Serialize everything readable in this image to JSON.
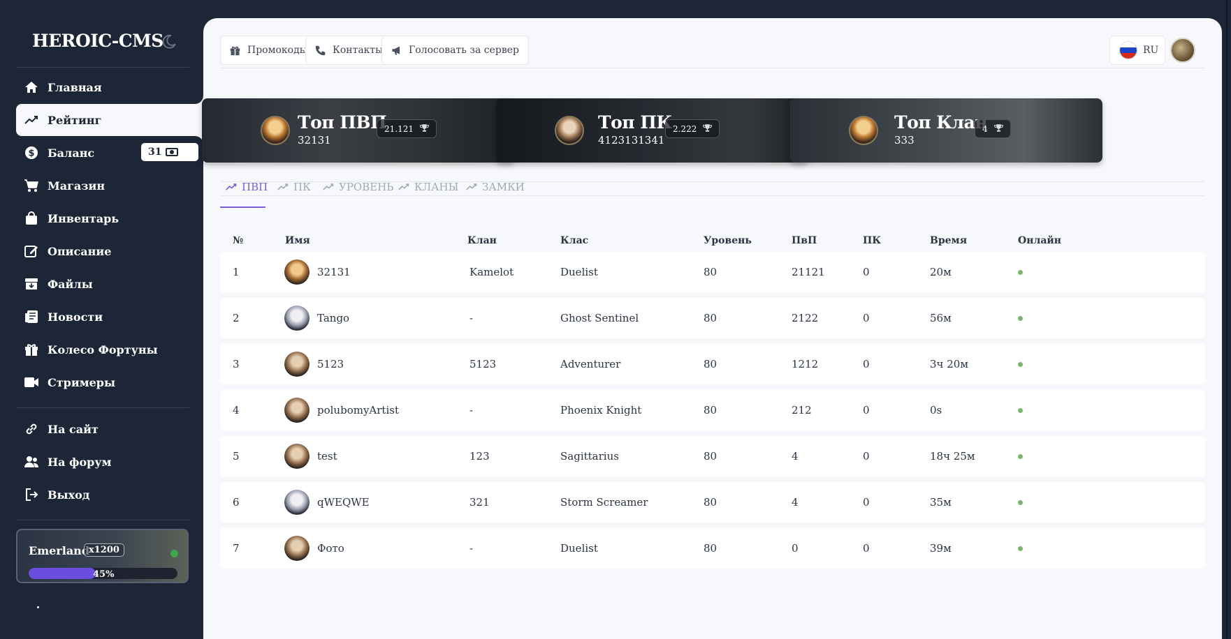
{
  "brand": "HEROIC-CMS",
  "sidebar": {
    "items": [
      {
        "label": "Главная",
        "icon": "home-icon"
      },
      {
        "label": "Рейтинг",
        "icon": "chart-line-icon",
        "active": true
      },
      {
        "label": "Баланс",
        "icon": "dollar-icon",
        "badge": "31"
      },
      {
        "label": "Магазин",
        "icon": "cart-icon"
      },
      {
        "label": "Инвентарь",
        "icon": "bag-icon"
      },
      {
        "label": "Описание",
        "icon": "edit-icon"
      },
      {
        "label": "Файлы",
        "icon": "archive-icon"
      },
      {
        "label": "Новости",
        "icon": "news-icon"
      },
      {
        "label": "Колесо Фортуны",
        "icon": "gift-icon"
      },
      {
        "label": "Стримеры",
        "icon": "video-icon"
      }
    ],
    "links": [
      {
        "label": "На сайт",
        "icon": "link-icon"
      },
      {
        "label": "На форум",
        "icon": "users-icon"
      },
      {
        "label": "Выход",
        "icon": "logout-icon"
      }
    ],
    "server": {
      "name": "Emerland",
      "rate": "x1200",
      "progress_percent": 45,
      "progress_label": "45%",
      "status_color": "#3ea84b"
    }
  },
  "header": {
    "buttons": [
      {
        "label": "Промокоды",
        "icon": "gift-icon"
      },
      {
        "label": "Контакты",
        "icon": "phone-icon"
      },
      {
        "label": "Голосовать за сервер",
        "icon": "megaphone-icon"
      }
    ],
    "language": "RU"
  },
  "top_cards": [
    {
      "title": "Топ ПВП",
      "name": "32131",
      "score": "21.121"
    },
    {
      "title": "Топ ПК",
      "name": "4123131341",
      "score": "2.222"
    },
    {
      "title": "Топ Клан",
      "name": "333",
      "score": "4"
    }
  ],
  "tabs": [
    {
      "label": "ПВП",
      "active": true
    },
    {
      "label": "ПК"
    },
    {
      "label": "УРОВЕНЬ"
    },
    {
      "label": "КЛАНЫ"
    },
    {
      "label": "ЗАМКИ"
    }
  ],
  "table": {
    "columns": [
      "№",
      "Имя",
      "Клан",
      "Клас",
      "Уровень",
      "ПвП",
      "ПК",
      "Время",
      "Онлайн"
    ],
    "rows": [
      {
        "n": "1",
        "name": "32131",
        "clan": "Kamelot",
        "class": "Duelist",
        "level": "80",
        "pvp": "21121",
        "pk": "0",
        "time": "20м",
        "avatar": "gold"
      },
      {
        "n": "2",
        "name": "Tango",
        "clan": "-",
        "class": "Ghost Sentinel",
        "level": "80",
        "pvp": "2122",
        "pk": "0",
        "time": "56м",
        "avatar": "pale"
      },
      {
        "n": "3",
        "name": "5123",
        "clan": "5123",
        "class": "Adventurer",
        "level": "80",
        "pvp": "1212",
        "pk": "0",
        "time": "3ч 20м",
        "avatar": "tan"
      },
      {
        "n": "4",
        "name": "polubomyArtist",
        "clan": "-",
        "class": "Phoenix Knight",
        "level": "80",
        "pvp": "212",
        "pk": "0",
        "time": "0s",
        "avatar": "tan"
      },
      {
        "n": "5",
        "name": "test",
        "clan": "123",
        "class": "Sagittarius",
        "level": "80",
        "pvp": "4",
        "pk": "0",
        "time": "18ч 25м",
        "avatar": "tan"
      },
      {
        "n": "6",
        "name": "qWEQWE",
        "clan": "321",
        "class": "Storm Screamer",
        "level": "80",
        "pvp": "4",
        "pk": "0",
        "time": "35м",
        "avatar": "pale"
      },
      {
        "n": "7",
        "name": "Фото",
        "clan": "-",
        "class": "Duelist",
        "level": "80",
        "pvp": "0",
        "pk": "0",
        "time": "39м",
        "avatar": "tan"
      }
    ]
  },
  "colors": {
    "sidebar": "#1c2637",
    "accent": "#7b5cd8",
    "online": "#7ab56c",
    "panel": "#f6f8fb"
  }
}
